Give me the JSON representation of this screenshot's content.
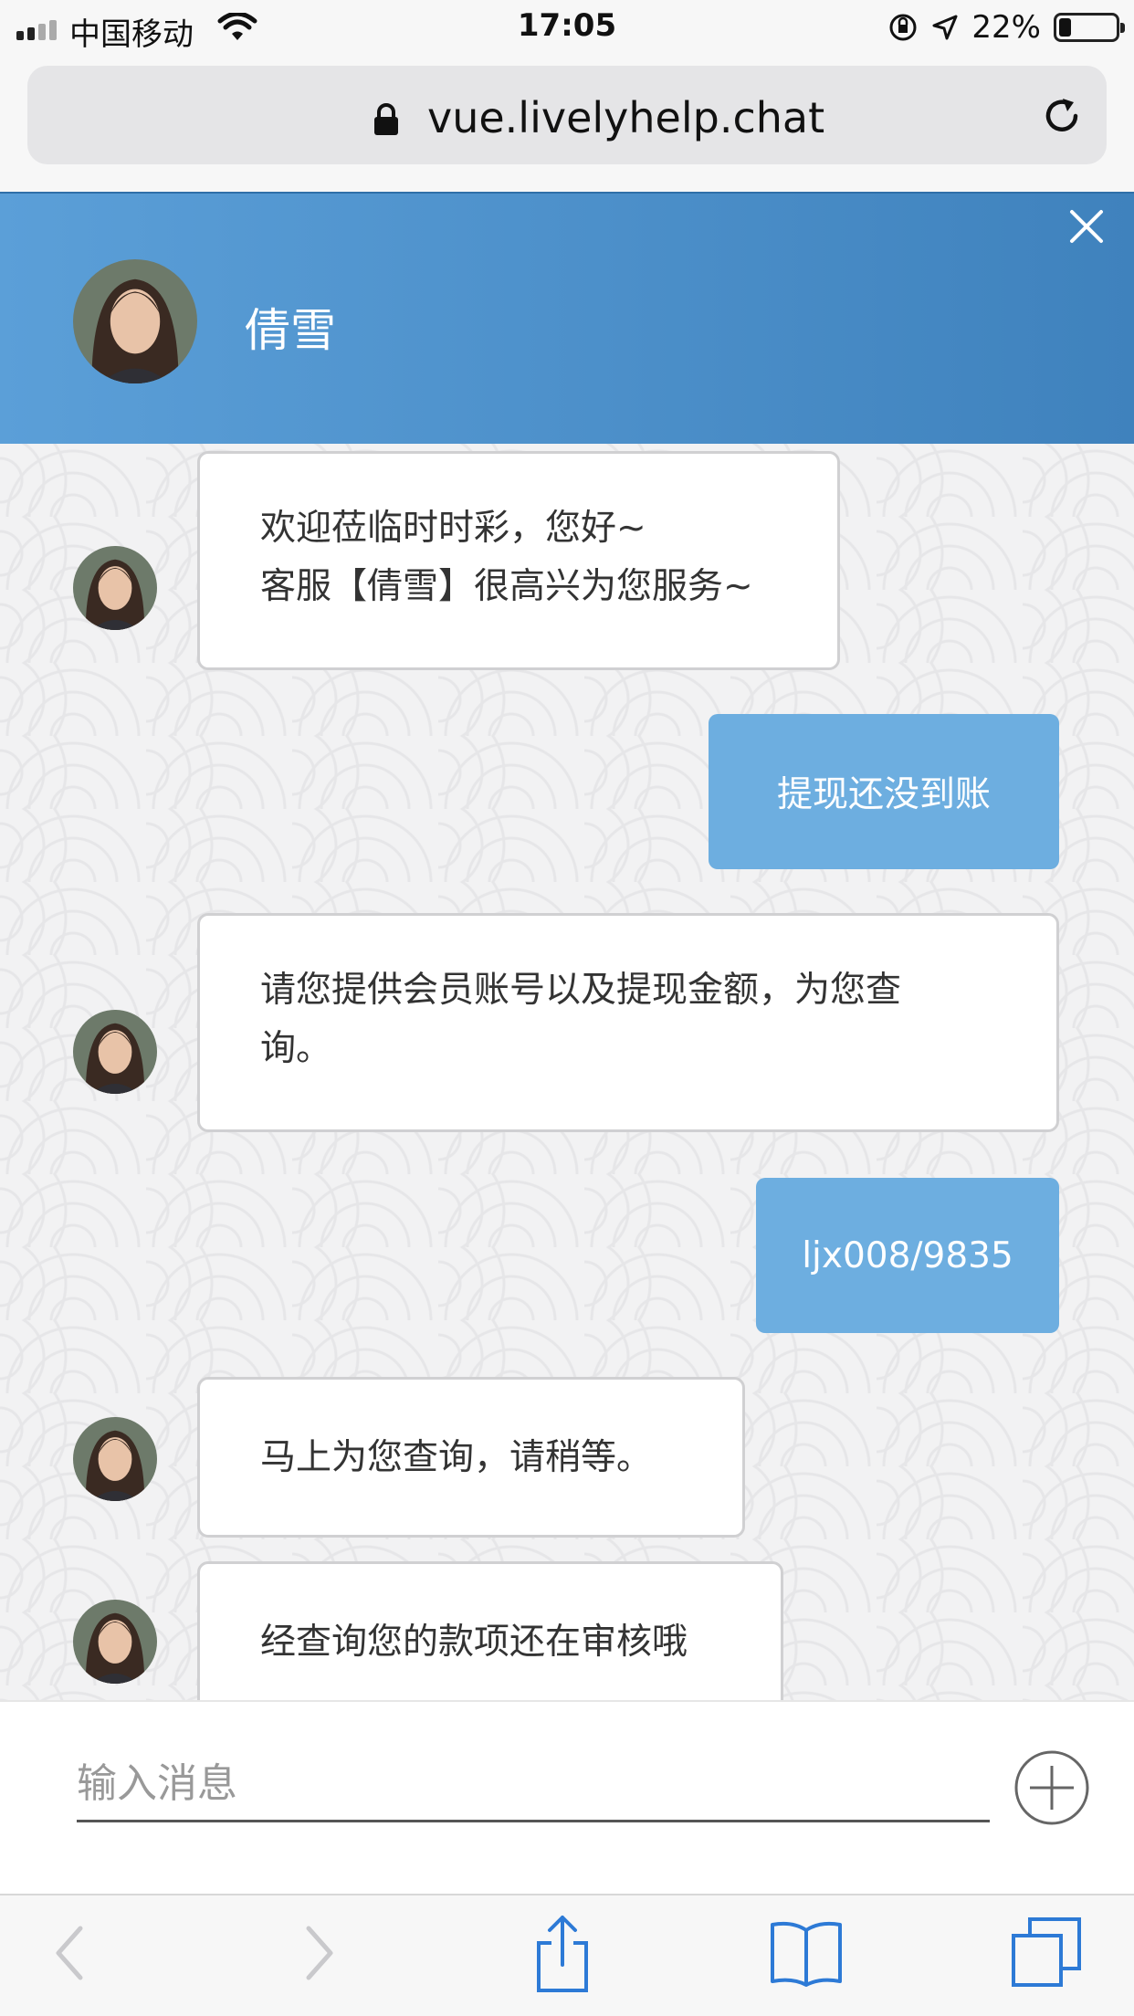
{
  "status_bar": {
    "carrier": "中国移动",
    "time": "17:05",
    "battery": "22%",
    "battery_level": 0.22
  },
  "browser": {
    "url": "vue.livelyhelp.chat"
  },
  "chat_header": {
    "agent_name": "倩雪"
  },
  "messages": [
    {
      "from": "agent",
      "lines": [
        "欢迎莅临时时彩，您好~",
        "客服【倩雪】很高兴为您服务~"
      ]
    },
    {
      "from": "user",
      "text": "提现还没到账"
    },
    {
      "from": "agent",
      "lines": [
        "请您提供会员账号以及提现金额，为您查",
        "询。"
      ]
    },
    {
      "from": "user",
      "text": "ljx008/9835"
    },
    {
      "from": "agent",
      "lines": [
        "马上为您查询，请稍等。"
      ]
    },
    {
      "from": "agent",
      "lines": [
        "经查询您的款项还在审核哦"
      ]
    }
  ],
  "composer": {
    "placeholder": "输入消息"
  },
  "colors": {
    "header": "#4a90cf",
    "user_bubble": "#6daee0"
  },
  "icons": [
    "lock-icon",
    "reload-icon",
    "close-icon",
    "plus-icon",
    "back-icon",
    "forward-icon",
    "share-icon",
    "bookmarks-icon",
    "tabs-icon"
  ]
}
